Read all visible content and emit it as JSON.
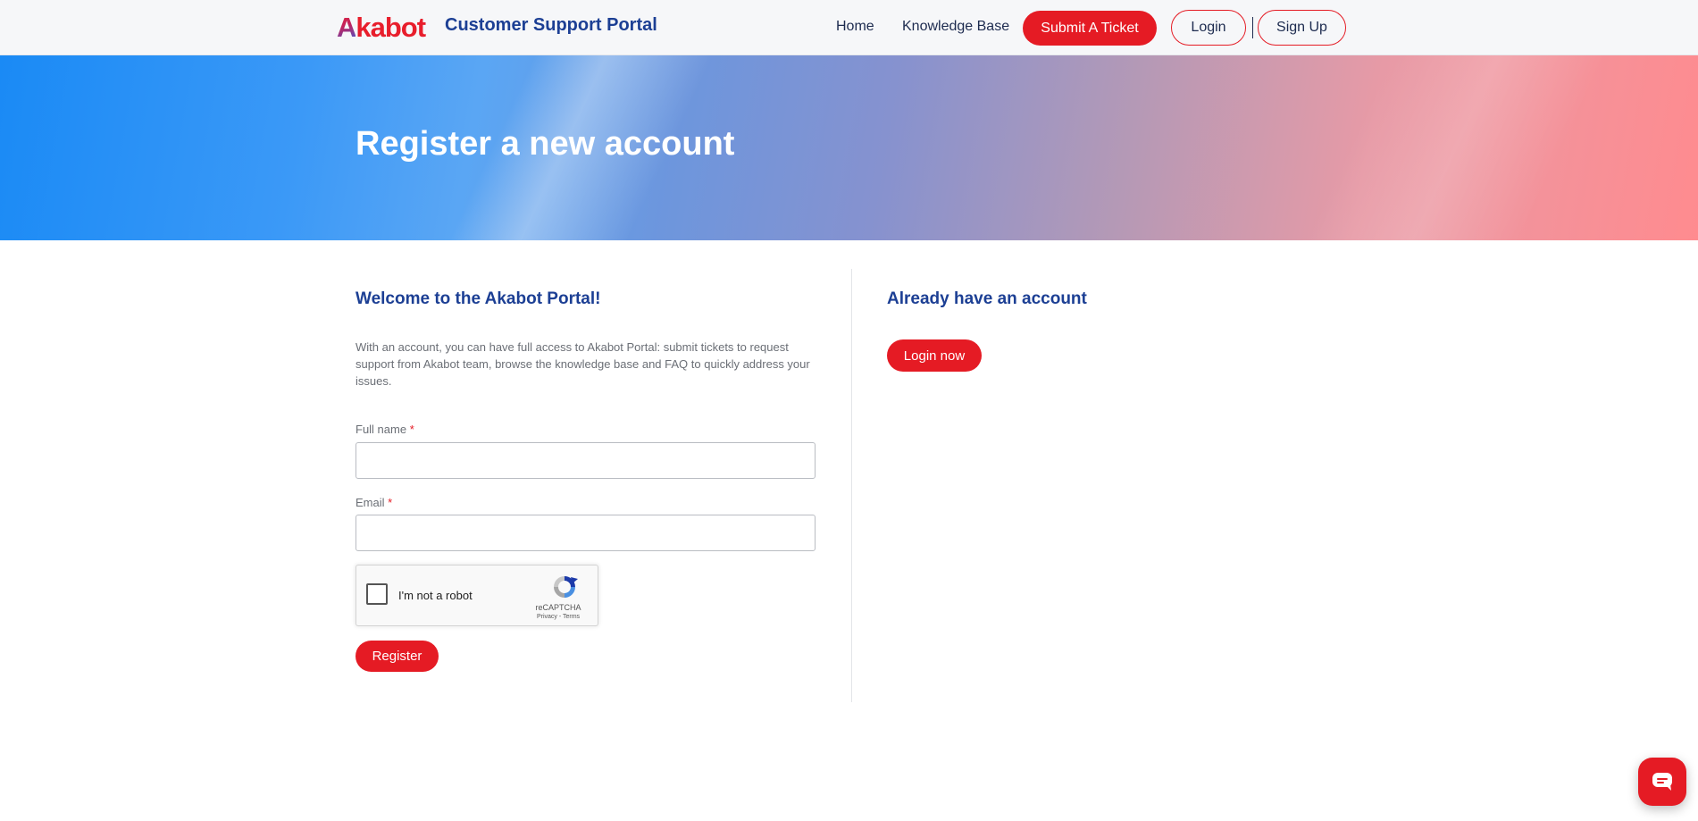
{
  "header": {
    "logo_text_first": "A",
    "logo_text_rest": "kabot",
    "portal_title": "Customer Support Portal",
    "nav": {
      "home": "Home",
      "knowledge_base": "Knowledge Base",
      "submit_ticket": "Submit A Ticket",
      "login": "Login",
      "signup": "Sign Up"
    }
  },
  "hero": {
    "title": "Register a new account"
  },
  "register": {
    "title": "Welcome to the Akabot Portal!",
    "intro": "With an account, you can have full access to Akabot Portal: submit tickets to request support from Akabot team, browse the knowledge base and FAQ to quickly address your issues.",
    "full_name_label": "Full name",
    "email_label": "Email",
    "required_mark": "*",
    "full_name_value": "",
    "email_value": "",
    "captcha_label": "I'm not a robot",
    "captcha_brand": "reCAPTCHA",
    "captcha_links": "Privacy - Terms",
    "submit_label": "Register"
  },
  "login_side": {
    "title": "Already have an account",
    "button_label": "Login now"
  },
  "icons": {
    "captcha": "recaptcha-icon",
    "chat": "chat-icon"
  },
  "colors": {
    "accent_red": "#e51b24",
    "heading_blue": "#1c3f94"
  }
}
